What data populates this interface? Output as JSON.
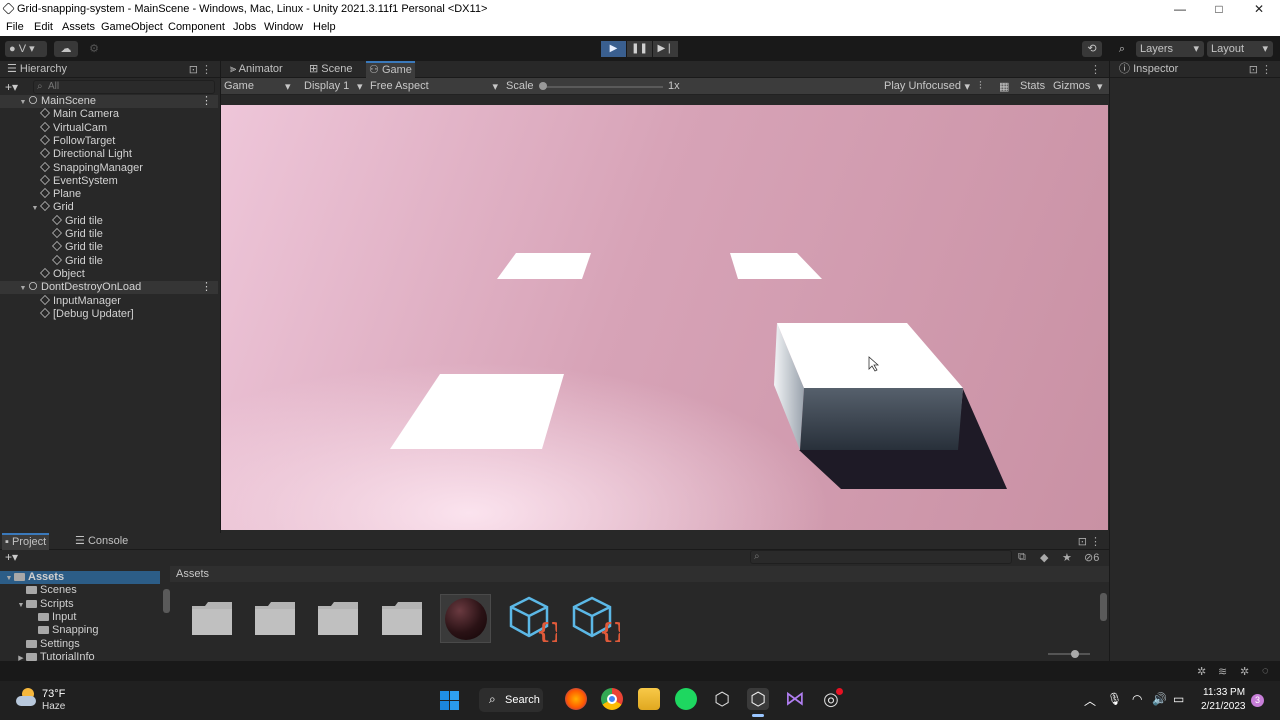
{
  "window": {
    "title": "Grid-snapping-system - MainScene - Windows, Mac, Linux - Unity 2021.3.11f1 Personal <DX11>",
    "minimize": "—",
    "maximize": "□",
    "close": "✕"
  },
  "menu": [
    "File",
    "Edit",
    "Assets",
    "GameObject",
    "Component",
    "Jobs",
    "Window",
    "Help"
  ],
  "toolbar": {
    "account": "V",
    "layers": "Layers",
    "layout": "Layout"
  },
  "hierarchy": {
    "tab": "Hierarchy",
    "search_placeholder": "All",
    "items": [
      {
        "label": "MainScene",
        "depth": 0,
        "kind": "scene",
        "expanded": true
      },
      {
        "label": "Main Camera",
        "depth": 1
      },
      {
        "label": "VirtualCam",
        "depth": 1
      },
      {
        "label": "FollowTarget",
        "depth": 1
      },
      {
        "label": "Directional Light",
        "depth": 1
      },
      {
        "label": "SnappingManager",
        "depth": 1
      },
      {
        "label": "EventSystem",
        "depth": 1
      },
      {
        "label": "Plane",
        "depth": 1
      },
      {
        "label": "Grid",
        "depth": 1,
        "expanded": true
      },
      {
        "label": "Grid tile",
        "depth": 2
      },
      {
        "label": "Grid tile",
        "depth": 2
      },
      {
        "label": "Grid tile",
        "depth": 2
      },
      {
        "label": "Grid tile",
        "depth": 2
      },
      {
        "label": "Object",
        "depth": 1
      },
      {
        "label": "DontDestroyOnLoad",
        "depth": 0,
        "kind": "scene",
        "expanded": true
      },
      {
        "label": "InputManager",
        "depth": 1
      },
      {
        "label": "[Debug Updater]",
        "depth": 1
      }
    ]
  },
  "game": {
    "tabs": [
      "Animator",
      "Scene",
      "Game"
    ],
    "active_tab": "Game",
    "mode": "Game",
    "display": "Display 1",
    "aspect": "Free Aspect",
    "scale_label": "Scale",
    "scale_value": "1x",
    "play_mode": "Play Unfocused",
    "stats": "Stats",
    "gizmos": "Gizmos"
  },
  "inspector": {
    "tab": "Inspector"
  },
  "project": {
    "tabs": [
      "Project",
      "Console"
    ],
    "breadcrumb": "Assets",
    "tree": [
      {
        "label": "Assets",
        "depth": 0
      },
      {
        "label": "Scenes",
        "depth": 1
      },
      {
        "label": "Scripts",
        "depth": 1
      },
      {
        "label": "Input",
        "depth": 2
      },
      {
        "label": "Snapping",
        "depth": 2
      },
      {
        "label": "Settings",
        "depth": 1
      },
      {
        "label": "TutorialInfo",
        "depth": 1
      }
    ],
    "hidden_count": "6"
  },
  "taskbar": {
    "weather_temp": "73°F",
    "weather_desc": "Haze",
    "search": "Search",
    "time": "11:33 PM",
    "date": "2/21/2023",
    "notif_count": "3"
  }
}
